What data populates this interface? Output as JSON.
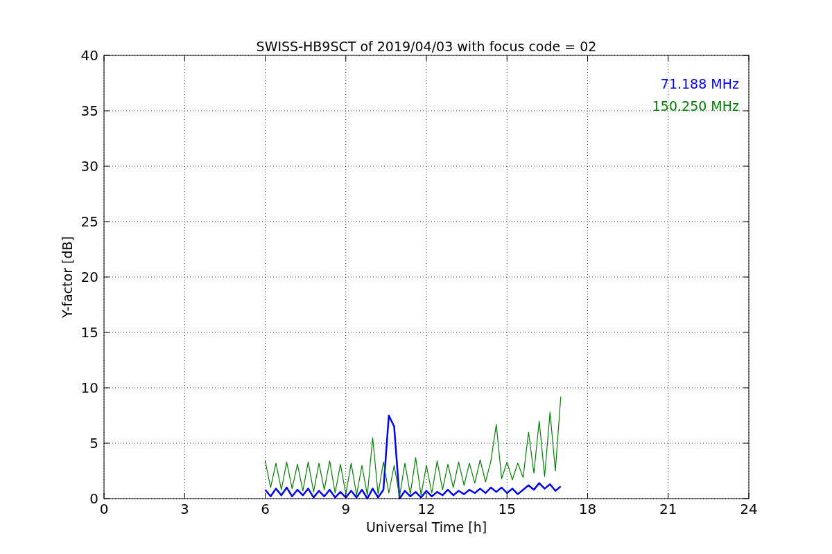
{
  "chart_data": {
    "type": "line",
    "title": "SWISS-HB9SCT of 2019/04/03 with focus code = 02",
    "xlabel": "Universal Time [h]",
    "ylabel": "Y-factor [dB]",
    "x": [
      6.0,
      6.2,
      6.4,
      6.6,
      6.8,
      7.0,
      7.2,
      7.4,
      7.6,
      7.8,
      8.0,
      8.2,
      8.4,
      8.6,
      8.8,
      9.0,
      9.2,
      9.4,
      9.6,
      9.8,
      10.0,
      10.2,
      10.4,
      10.6,
      10.8,
      11.0,
      11.2,
      11.4,
      11.6,
      11.8,
      12.0,
      12.2,
      12.4,
      12.6,
      12.8,
      13.0,
      13.2,
      13.4,
      13.6,
      13.8,
      14.0,
      14.2,
      14.4,
      14.6,
      14.8,
      15.0,
      15.2,
      15.4,
      15.6,
      15.8,
      16.0,
      16.2,
      16.4,
      16.6,
      16.8,
      17.0
    ],
    "series": [
      {
        "name": "71.188 MHz",
        "color": "#0000ff",
        "values": [
          0.8,
          0.2,
          0.9,
          0.3,
          1.0,
          0.2,
          0.8,
          0.3,
          0.9,
          0.1,
          0.7,
          0.2,
          0.8,
          0.1,
          0.6,
          0.1,
          0.7,
          0.1,
          0.8,
          0.0,
          0.9,
          0.1,
          0.8,
          7.5,
          6.5,
          0.0,
          0.7,
          0.2,
          0.6,
          0.1,
          0.7,
          0.2,
          0.6,
          0.3,
          0.8,
          0.3,
          0.7,
          0.4,
          0.8,
          0.5,
          0.9,
          0.5,
          1.0,
          0.6,
          1.0,
          0.5,
          0.9,
          0.4,
          0.8,
          1.2,
          0.8,
          1.4,
          0.9,
          1.3,
          0.7,
          1.1
        ]
      },
      {
        "name": "150.250 MHz",
        "color": "#008000",
        "values": [
          3.4,
          1.0,
          3.2,
          0.8,
          3.3,
          0.9,
          3.1,
          0.7,
          3.3,
          0.6,
          3.2,
          0.8,
          3.4,
          0.5,
          3.1,
          0.4,
          3.2,
          0.3,
          3.0,
          0.3,
          5.5,
          0.4,
          3.3,
          0.5,
          3.0,
          0.2,
          3.2,
          0.4,
          3.7,
          0.3,
          3.0,
          0.5,
          3.4,
          0.8,
          3.1,
          1.0,
          3.3,
          1.2,
          3.2,
          1.4,
          3.5,
          1.5,
          3.4,
          6.7,
          1.8,
          3.3,
          1.7,
          3.2,
          1.9,
          6.0,
          2.3,
          7.0,
          2.0,
          7.8,
          2.5,
          9.2
        ]
      }
    ],
    "grid": true,
    "xlim": [
      0,
      24
    ],
    "ylim": [
      0,
      40
    ],
    "xticks": [
      0,
      3,
      6,
      9,
      12,
      15,
      18,
      21,
      24
    ],
    "yticks": [
      0,
      5,
      10,
      15,
      20,
      25,
      30,
      35,
      40
    ]
  }
}
